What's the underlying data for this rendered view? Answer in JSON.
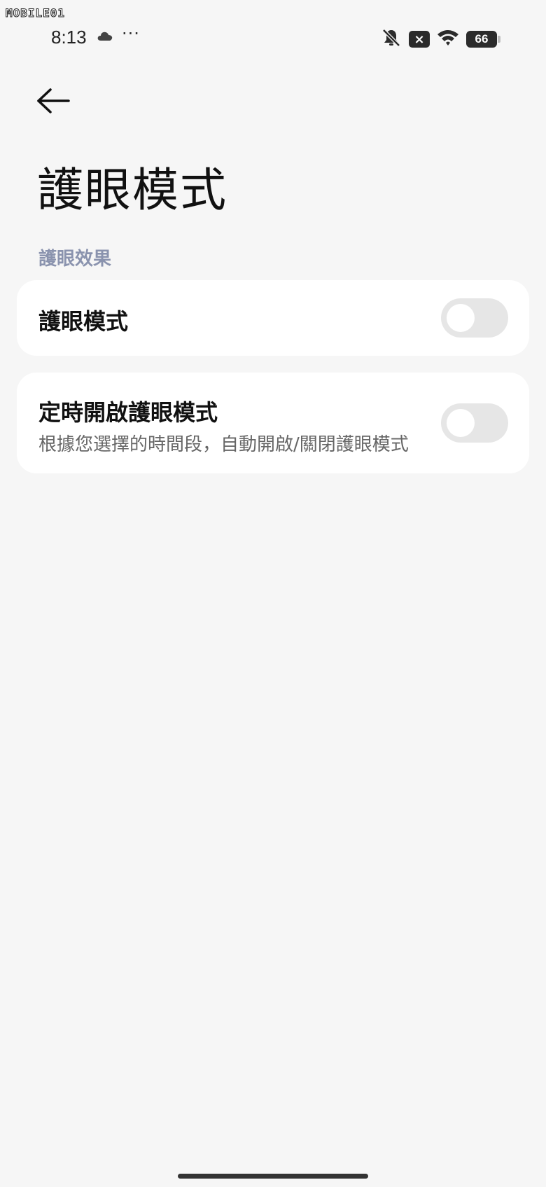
{
  "watermark": {
    "text": "MOBILE01"
  },
  "status_bar": {
    "time": "8:13",
    "more": "···",
    "x_badge": "×",
    "battery_level": "66"
  },
  "header": {
    "back_icon": "arrow-left-icon",
    "title": "護眼模式"
  },
  "section": {
    "label": "護眼效果"
  },
  "settings": [
    {
      "title": "護眼模式",
      "subtitle": "",
      "enabled": false
    },
    {
      "title": "定時開啟護眼模式",
      "subtitle": "根據您選擇的時間段，自動開啟/關閉護眼模式",
      "enabled": false
    }
  ],
  "colors": {
    "background": "#f6f6f6",
    "card": "#ffffff",
    "section_label": "#8a93ae",
    "toggle_off": "#e6e6e6"
  }
}
